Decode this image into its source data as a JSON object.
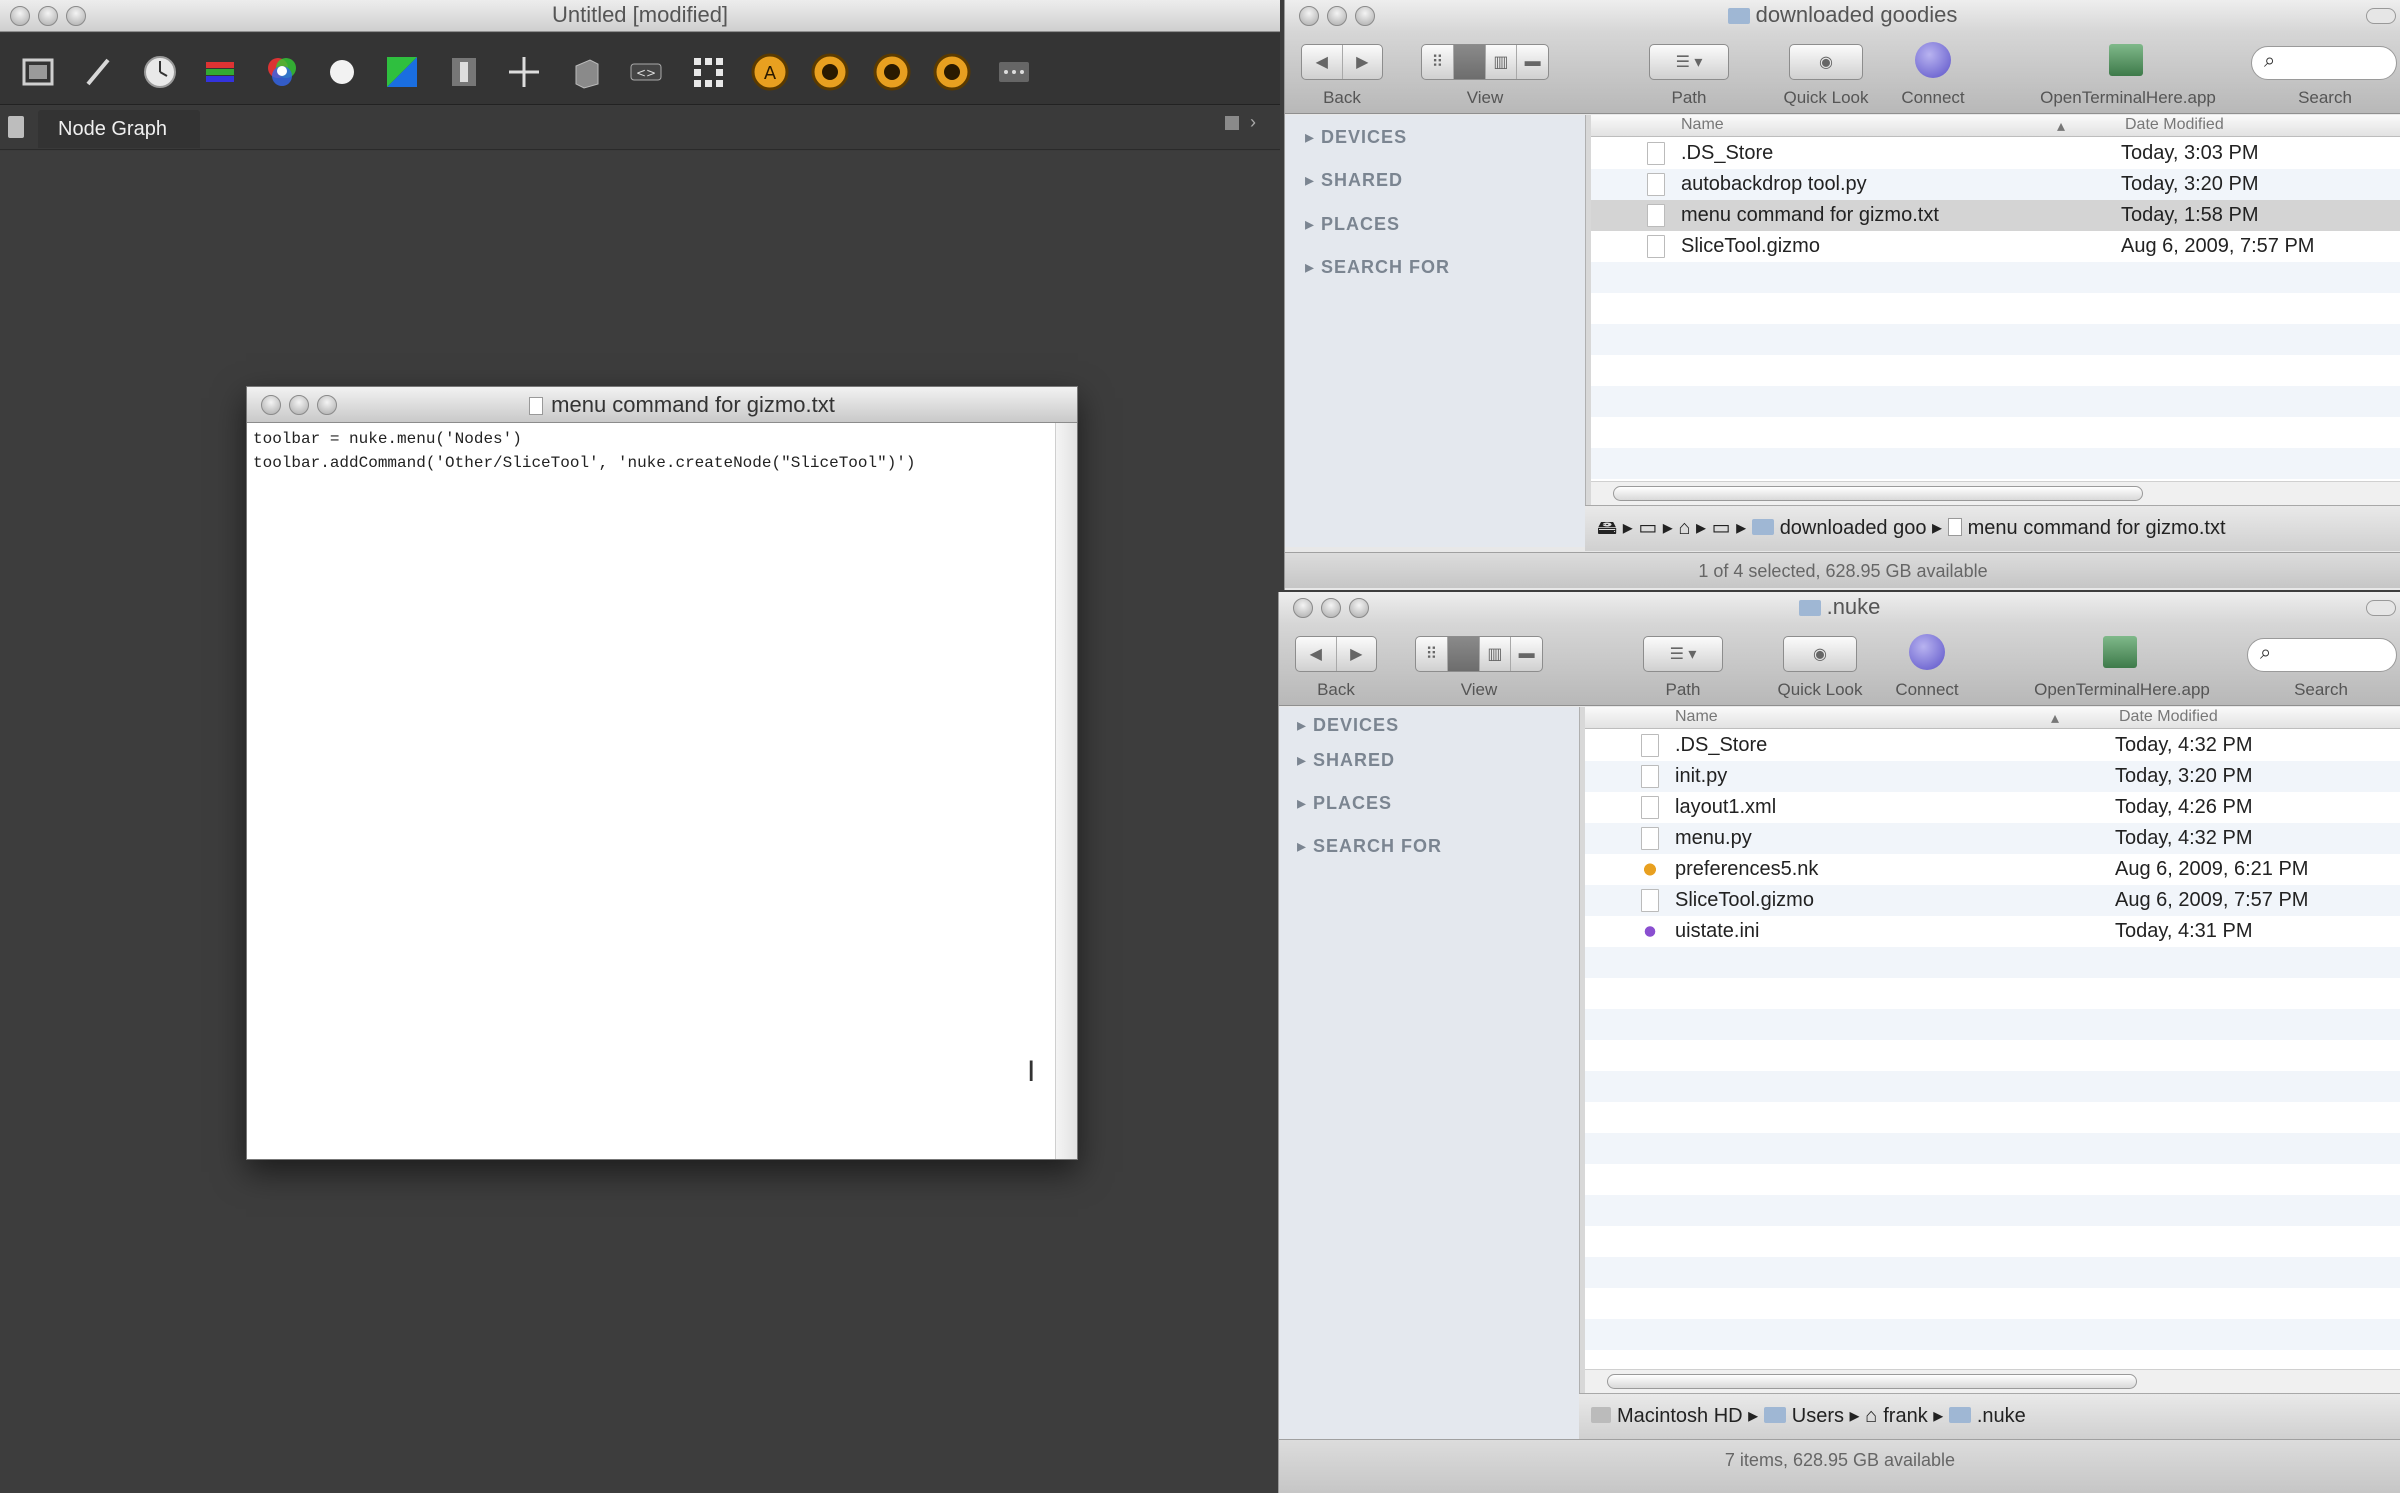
{
  "nuke": {
    "window_title": "Untitled [modified]",
    "tab_label": "Node Graph",
    "toolbar_icons": [
      "image-icon",
      "draw-icon",
      "time-icon",
      "channel-icon",
      "color-icon",
      "filter-icon",
      "keyer-icon",
      "merge-icon",
      "transform-icon",
      "3d-icon",
      "views-icon",
      "metadata-icon",
      "gizmo-icon-1",
      "gizmo-icon-2",
      "gizmo-icon-3",
      "gizmo-icon-4",
      "other-icon"
    ]
  },
  "textedit": {
    "title": "menu command for gizmo.txt",
    "line1": "toolbar = nuke.menu('Nodes')",
    "line2": "toolbar.addCommand('Other/SliceTool', 'nuke.createNode(\"SliceTool\")')"
  },
  "finder_top": {
    "title": "downloaded goodies",
    "toolbar": {
      "back": "Back",
      "view": "View",
      "path": "Path",
      "quicklook": "Quick Look",
      "connect": "Connect",
      "terminal": "OpenTerminalHere.app",
      "search": "Search"
    },
    "sidebar": [
      "DEVICES",
      "SHARED",
      "PLACES",
      "SEARCH FOR"
    ],
    "columns": {
      "name": "Name",
      "date": "Date Modified"
    },
    "rows": [
      {
        "name": ".DS_Store",
        "date": "Today, 3:03 PM"
      },
      {
        "name": "autobackdrop tool.py",
        "date": "Today, 3:20 PM"
      },
      {
        "name": "menu command for gizmo.txt",
        "date": "Today, 1:58 PM"
      },
      {
        "name": "SliceTool.gizmo",
        "date": "Aug 6, 2009, 7:57 PM"
      }
    ],
    "path": [
      "downloaded goo",
      "menu command for gizmo.txt"
    ],
    "status": "1 of 4 selected, 628.95 GB available"
  },
  "finder_bottom": {
    "title": ".nuke",
    "toolbar": {
      "back": "Back",
      "view": "View",
      "path": "Path",
      "quicklook": "Quick Look",
      "connect": "Connect",
      "terminal": "OpenTerminalHere.app",
      "search": "Search"
    },
    "sidebar": [
      "DEVICES",
      "SHARED",
      "PLACES",
      "SEARCH FOR"
    ],
    "columns": {
      "name": "Name",
      "date": "Date Modified"
    },
    "rows": [
      {
        "name": ".DS_Store",
        "date": "Today, 4:32 PM"
      },
      {
        "name": "init.py",
        "date": "Today, 3:20 PM"
      },
      {
        "name": "layout1.xml",
        "date": "Today, 4:26 PM"
      },
      {
        "name": "menu.py",
        "date": "Today, 4:32 PM"
      },
      {
        "name": "preferences5.nk",
        "date": "Aug 6, 2009, 6:21 PM"
      },
      {
        "name": "SliceTool.gizmo",
        "date": "Aug 6, 2009, 7:57 PM"
      },
      {
        "name": "uistate.ini",
        "date": "Today, 4:31 PM"
      }
    ],
    "path": [
      "Macintosh HD",
      "Users",
      "frank",
      ".nuke"
    ],
    "status": "7 items, 628.95 GB available"
  }
}
